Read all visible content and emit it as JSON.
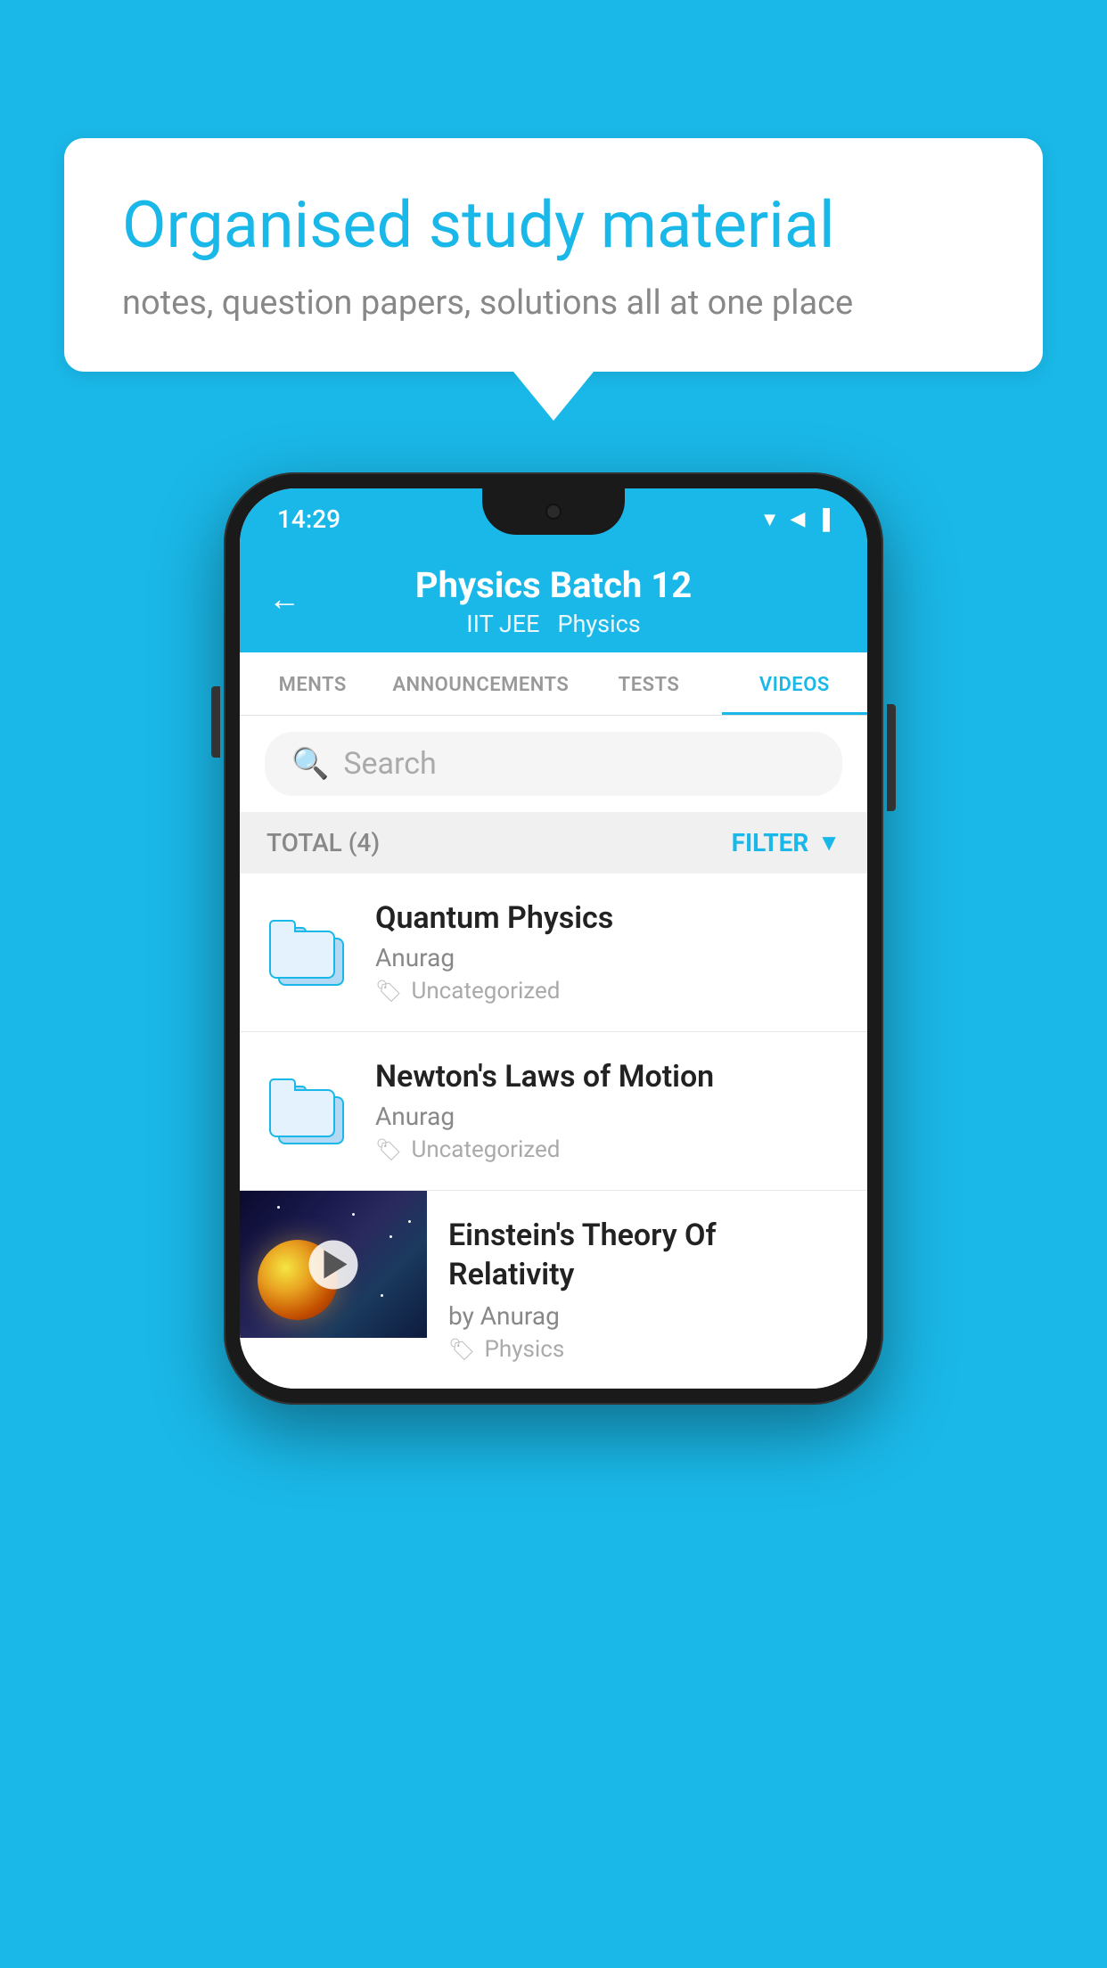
{
  "background_color": "#1ab8e8",
  "speech_bubble": {
    "title": "Organised study material",
    "subtitle": "notes, question papers, solutions all at one place"
  },
  "phone": {
    "status_bar": {
      "time": "14:29",
      "icons": [
        "wifi",
        "signal",
        "battery"
      ]
    },
    "header": {
      "title": "Physics Batch 12",
      "subtitle_parts": [
        "IIT JEE",
        "Physics"
      ],
      "back_label": "←"
    },
    "tabs": [
      {
        "label": "MENTS",
        "active": false
      },
      {
        "label": "ANNOUNCEMENTS",
        "active": false
      },
      {
        "label": "TESTS",
        "active": false
      },
      {
        "label": "VIDEOS",
        "active": true
      }
    ],
    "search": {
      "placeholder": "Search"
    },
    "filter_bar": {
      "total_label": "TOTAL (4)",
      "filter_label": "FILTER"
    },
    "videos": [
      {
        "title": "Quantum Physics",
        "author": "Anurag",
        "tag": "Uncategorized",
        "has_thumbnail": false
      },
      {
        "title": "Newton's Laws of Motion",
        "author": "Anurag",
        "tag": "Uncategorized",
        "has_thumbnail": false
      },
      {
        "title": "Einstein's Theory Of Relativity",
        "author": "by Anurag",
        "tag": "Physics",
        "has_thumbnail": true
      }
    ]
  }
}
